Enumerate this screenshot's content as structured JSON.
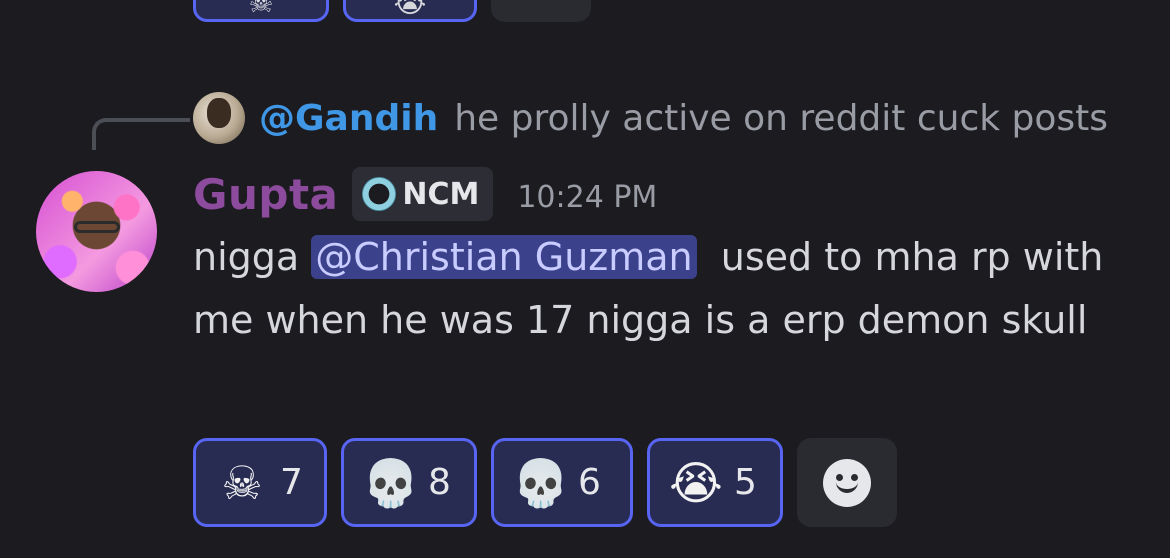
{
  "top_reactions": [
    {
      "icon": "skull-crossbones-icon",
      "glyph": "☠"
    },
    {
      "icon": "loudly-crying-face-icon",
      "glyph": "😭"
    }
  ],
  "reply": {
    "author": "@Gandih",
    "text": "he prolly active on reddit cuck posts"
  },
  "message": {
    "author": "Gupta",
    "tag": "NCM",
    "timestamp": "10:24 PM",
    "text_before": "nigga ",
    "mention": "@Christian Guzman",
    "text_after": "  used to mha rp with me when he was 17 nigga is a erp demon skull"
  },
  "reactions": [
    {
      "icon": "skull-crossbones-icon",
      "glyph": "☠",
      "count": "7"
    },
    {
      "icon": "skull-icon",
      "glyph": "💀",
      "count": "8"
    },
    {
      "icon": "ghost-skull-icon",
      "glyph": "💀",
      "count": "6"
    },
    {
      "icon": "loudly-crying-face-icon",
      "glyph": "😭",
      "count": "5"
    }
  ],
  "colors": {
    "background": "#1b1b20",
    "username": "#8c4b9c",
    "reply_name": "#3f97e6",
    "mention_bg": "#3c418c",
    "reaction_border": "#5865f2"
  }
}
